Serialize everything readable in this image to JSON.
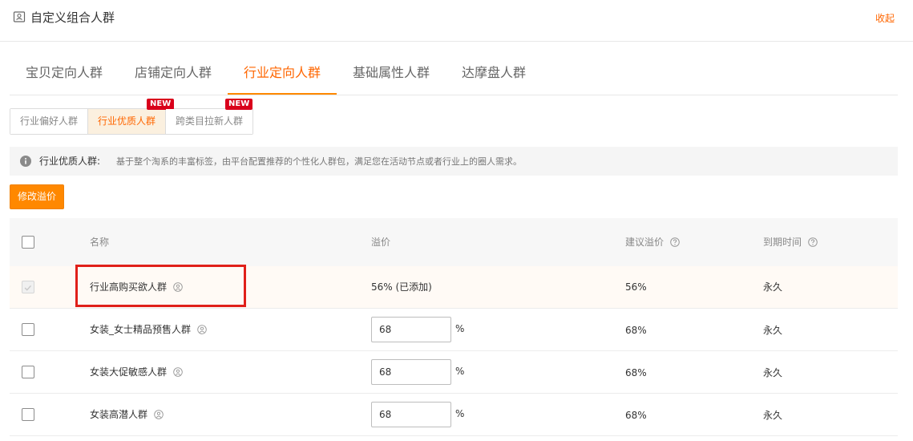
{
  "header": {
    "title": "自定义组合人群",
    "collapse_label": "收起",
    "icon": "group-card-icon"
  },
  "tabs": [
    {
      "label": "宝贝定向人群"
    },
    {
      "label": "店铺定向人群"
    },
    {
      "label": "行业定向人群",
      "active": true
    },
    {
      "label": "基础属性人群"
    },
    {
      "label": "达摩盘人群"
    }
  ],
  "subtabs": [
    {
      "label": "行业偏好人群"
    },
    {
      "label": "行业优质人群",
      "active": true,
      "badge": "NEW"
    },
    {
      "label": "跨类目拉新人群",
      "badge": "NEW"
    }
  ],
  "notice": {
    "label": "行业优质人群:",
    "text": "基于整个淘系的丰富标签，由平台配置推荐的个性化人群包，满足您在活动节点或者行业上的圈人需求。",
    "icon": "info-icon"
  },
  "actions": {
    "modify_premium_label": "修改溢价"
  },
  "table": {
    "columns": {
      "name": "名称",
      "premium": "溢价",
      "suggested": "建议溢价",
      "expiry": "到期时间"
    },
    "rows": [
      {
        "name": "行业高购买欲人群",
        "premium_text": "56% (已添加)",
        "suggested": "56%",
        "expiry": "永久",
        "added": true
      },
      {
        "name": "女装_女士精品预售人群",
        "premium_value": "68",
        "unit": "%",
        "suggested": "68%",
        "expiry": "永久"
      },
      {
        "name": "女装大促敏感人群",
        "premium_value": "68",
        "unit": "%",
        "suggested": "68%",
        "expiry": "永久"
      },
      {
        "name": "女装高潜人群",
        "premium_value": "68",
        "unit": "%",
        "suggested": "68%",
        "expiry": "永久"
      }
    ]
  },
  "colors": {
    "accent": "#ff6600",
    "button": "#ff8800",
    "badge": "#d9001b",
    "highlight_box": "#e0201a"
  }
}
